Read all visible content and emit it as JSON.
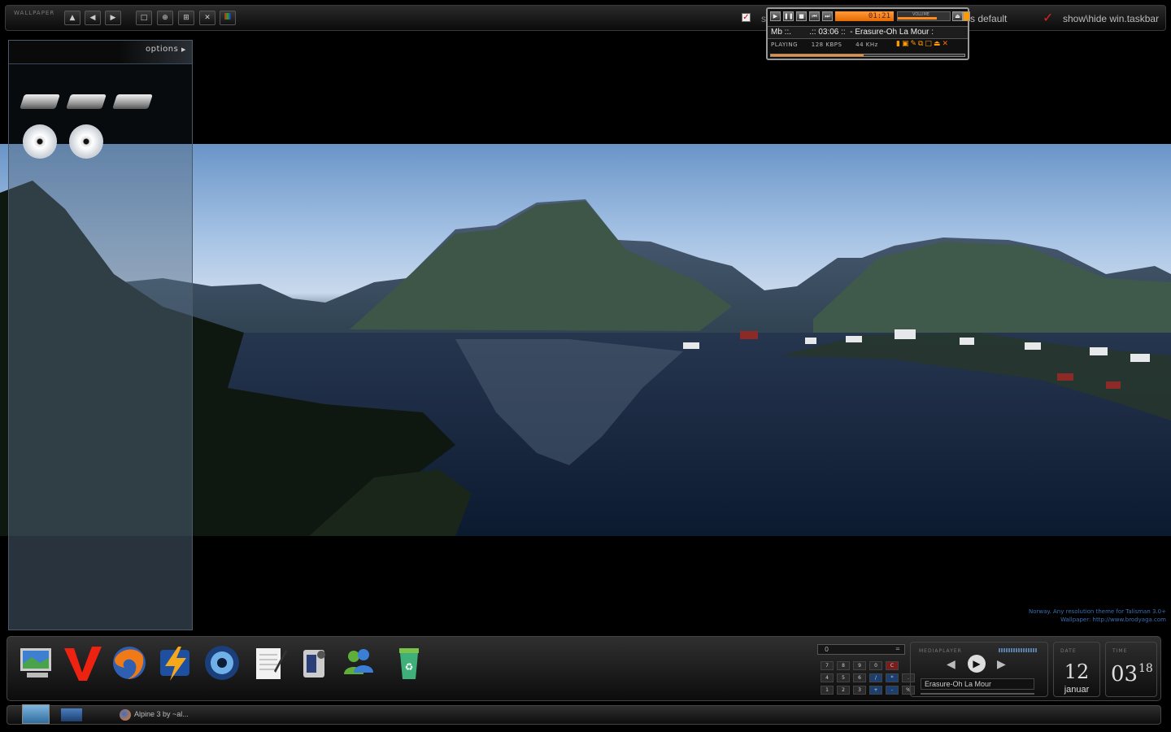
{
  "topbar": {
    "label": "WALLPAPER",
    "option1": "s default",
    "option2": "show\\hide win.taskbar",
    "first_letter": "s"
  },
  "player": {
    "time": "01:21",
    "track": "Mb ::.        .:: 03:06 ::  - Erasure-Oh La Mour :",
    "status": "PLAYING",
    "bitrate": "128 KBPS",
    "samplerate": "44 KHz",
    "volume_label": "VOLUME",
    "volume": 0.75,
    "seek": 0.48
  },
  "sidebar": {
    "options_label": "options",
    "drives": [
      "hard-drive",
      "hard-drive",
      "hard-drive"
    ],
    "cds": [
      "cd-drive",
      "cd-drive"
    ]
  },
  "credits": {
    "line1": "Norway. Any resolution theme for Talisman 3.0+",
    "line2": "Wallpaper:  http://www.brodyaga.com"
  },
  "dock": {
    "icons": [
      "my-computer",
      "vivaldi-v",
      "firefox",
      "winamp",
      "media-player",
      "notepad",
      "camcorder",
      "messenger",
      "recycle-bin"
    ]
  },
  "calc": {
    "display": "0",
    "rows": [
      [
        "7",
        "8",
        "9",
        "0",
        "C"
      ],
      [
        "4",
        "5",
        "6",
        "/",
        "*",
        "."
      ],
      [
        "1",
        "2",
        "3",
        "+",
        "-",
        "%"
      ]
    ]
  },
  "mediaplayer": {
    "label": "MEDIAPLAYER",
    "song": "Erasure-Oh La Mour"
  },
  "date": {
    "label": "DATE",
    "day": "12",
    "month": "januar"
  },
  "time": {
    "label": "TIME",
    "hour": "03",
    "minute": "18"
  },
  "taskbar": {
    "task": "Alpine 3 by ~al..."
  }
}
